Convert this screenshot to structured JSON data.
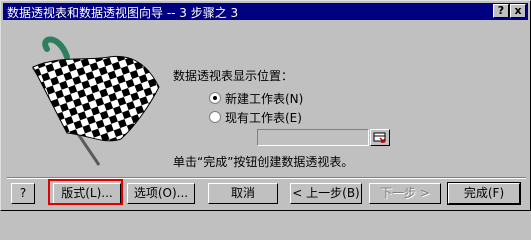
{
  "window": {
    "title": "数据透视表和数据透视图向导 -- 3 步骤之 3",
    "help_label": "?",
    "close_label": "x"
  },
  "content": {
    "position_label": "数据透视表显示位置：",
    "options": [
      {
        "label": "新建工作表(N)",
        "selected": true
      },
      {
        "label": "现有工作表(E)",
        "selected": false
      }
    ],
    "location_value": "",
    "hint": "单击“完成”按钮创建数据透视表。"
  },
  "buttons": {
    "help": "?",
    "layout": "版式(L)...",
    "options": "选项(O)...",
    "cancel": "取消",
    "back": "< 上一步(B)",
    "next": "下一步 >",
    "finish": "完成(F)"
  },
  "colors": {
    "title_bar": "#000080",
    "window_bg": "#c0c0c0",
    "highlight": "#e00000"
  },
  "icons": {
    "illustration": "checkered-flag-icon",
    "reference": "collapse-dialog-icon"
  }
}
